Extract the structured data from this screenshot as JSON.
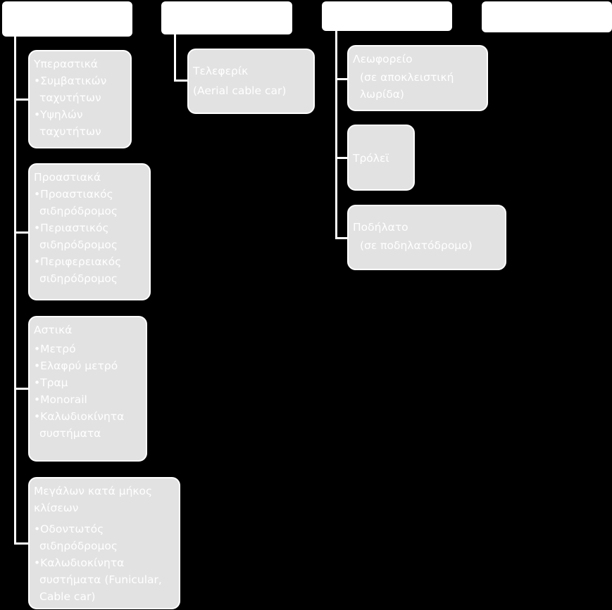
{
  "columns": [
    {
      "header": "",
      "boxes": [
        {
          "title": "Υπεραστικά",
          "items": [
            "Συμβατικών ταχυτήτων",
            "Υψηλών ταχυτήτων"
          ]
        },
        {
          "title": "Προαστιακά",
          "items": [
            "Προαστιακός σιδηρόδρομος",
            "Περιαστικός σιδηρόδρομος",
            "Περιφερειακός σιδηρόδρομος"
          ]
        },
        {
          "title": "Αστικά",
          "items": [
            "Μετρό",
            "Ελαφρύ μετρό",
            "Τραμ",
            "Monorail",
            "Καλωδιοκίνητα συστήματα"
          ]
        },
        {
          "title": "Μεγάλων κατά μήκος κλίσεων",
          "items": [
            "Οδοντωτός σιδηρόδρομος",
            "Καλωδιοκίνητα συστήματα (Funicular, Cable car)"
          ]
        }
      ]
    },
    {
      "header": "",
      "boxes": [
        {
          "title": "Τελεφερίκ",
          "subtitle": "(Aerial cable car)"
        }
      ]
    },
    {
      "header": "",
      "boxes": [
        {
          "title": "Λεωφορείο",
          "subtitle": "(σε αποκλειστική λωρίδα)"
        },
        {
          "title": "Τρόλεϊ"
        },
        {
          "title": "Ποδήλατο",
          "subtitle": "(σε ποδηλατόδρομο)"
        }
      ]
    },
    {
      "header": "",
      "boxes": []
    }
  ],
  "colors": {
    "background": "#000000",
    "header_fill": "#ffffff",
    "box_fill": "#e2e2e2",
    "text": "#ffffff"
  }
}
